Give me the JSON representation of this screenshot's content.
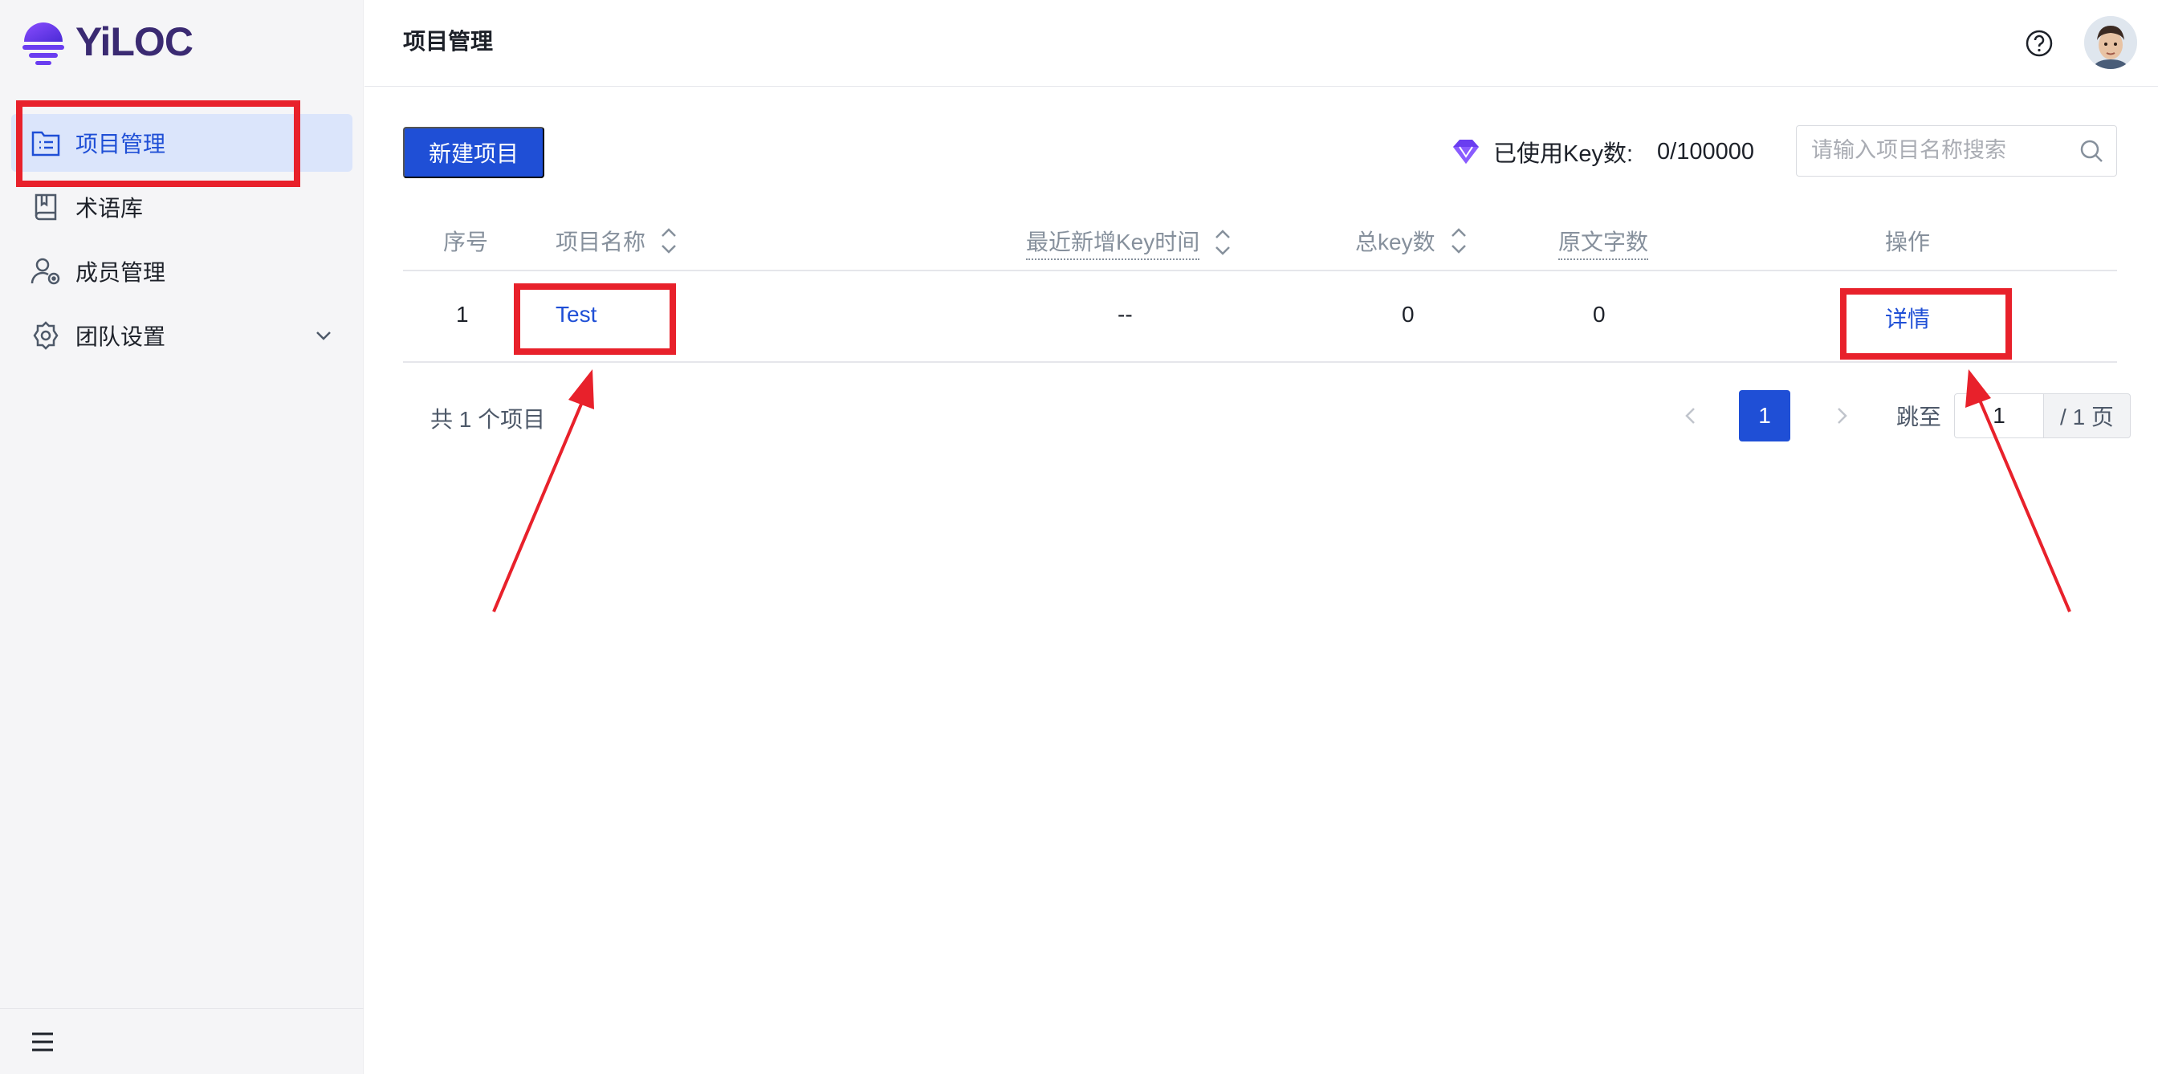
{
  "brand": {
    "name": "YiLOC"
  },
  "sidebar": {
    "items": [
      {
        "label": "项目管理",
        "icon": "folder-list-icon",
        "active": true
      },
      {
        "label": "术语库",
        "icon": "book-icon"
      },
      {
        "label": "成员管理",
        "icon": "user-settings-icon"
      },
      {
        "label": "团队设置",
        "icon": "gear-icon",
        "expandable": true
      }
    ]
  },
  "header": {
    "title": "项目管理",
    "help_icon": "help-circle-icon",
    "avatar_icon": "avatar-icon"
  },
  "toolbar": {
    "new_project_label": "新建项目",
    "usage_label": "已使用Key数:",
    "usage_value": "0/100000",
    "search_placeholder": "请输入项目名称搜索"
  },
  "table": {
    "columns": [
      "序号",
      "项目名称",
      "最近新增Key时间",
      "总key数",
      "原文字数",
      "操作"
    ],
    "rows": [
      {
        "index": "1",
        "name": "Test",
        "last_key_time": "--",
        "total_keys": "0",
        "source_chars": "0",
        "action": "详情"
      }
    ]
  },
  "pagination": {
    "total_label": "共 1 个项目",
    "current_page": "1",
    "jump_label": "跳至",
    "jump_value": "1",
    "page_suffix": "/ 1 页"
  },
  "colors": {
    "primary": "#1f4fd6",
    "annotation": "#e8212b",
    "brand": "#6a3df0"
  }
}
